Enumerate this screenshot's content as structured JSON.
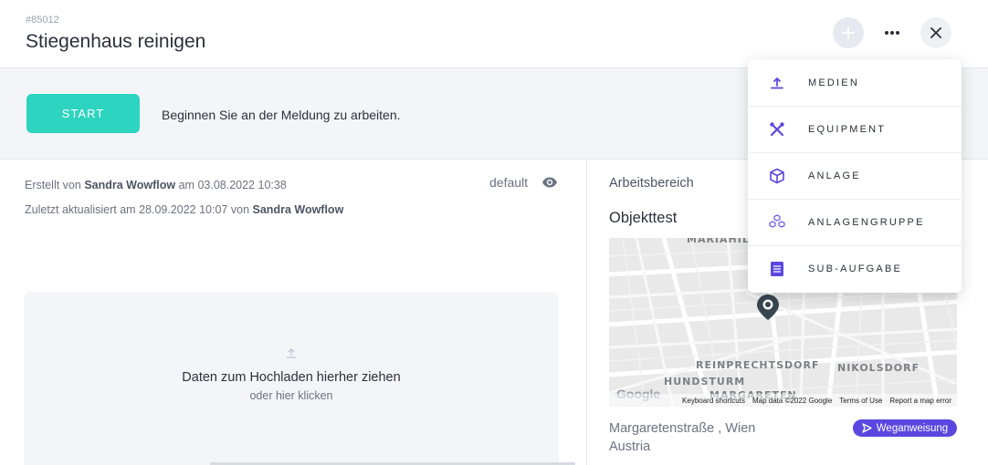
{
  "header": {
    "ticket_id": "#85012",
    "title": "Stiegenhaus reinigen",
    "add_icon": "plus-icon",
    "more_icon": "ellipsis-icon",
    "close_icon": "close-icon"
  },
  "start_band": {
    "start_label": "START",
    "hint": "Beginnen Sie an der Meldung zu arbeiten."
  },
  "meta": {
    "created_prefix": "Erstellt von",
    "created_by": "Sandra Wowflow",
    "created_mid": "am",
    "created_at": "03.08.2022 10:38",
    "updated_prefix": "Zuletzt aktualisiert am",
    "updated_at": "28.09.2022 10:07",
    "updated_mid": "von",
    "updated_by": "Sandra Wowflow",
    "view_label": "default"
  },
  "dropzone": {
    "title": "Daten zum Hochladen hierher ziehen",
    "subtitle": "oder hier klicken"
  },
  "work_area": {
    "label": "Arbeitsbereich",
    "object_name": "Objekttest"
  },
  "map": {
    "labels": [
      "MARIAHILF",
      "REINPRECHTSDORF",
      "NIKOLSDORF",
      "HUNDSTURM",
      "MARGARETEN"
    ],
    "google": "Google",
    "footer": [
      "Keyboard shortcuts",
      "Map data ©2022 Google",
      "Terms of Use",
      "Report a map error"
    ]
  },
  "address": {
    "line1": "Margaretenstraße , Wien",
    "line2": "Austria",
    "route_label": "Weganweisung"
  },
  "dropdown": {
    "items": [
      {
        "label": "MEDIEN",
        "icon": "upload-icon"
      },
      {
        "label": "EQUIPMENT",
        "icon": "tools-icon"
      },
      {
        "label": "ANLAGE",
        "icon": "cube-icon"
      },
      {
        "label": "ANLAGENGRUPPE",
        "icon": "cubes-icon"
      },
      {
        "label": "SUB-AUFGABE",
        "icon": "list-icon"
      }
    ]
  },
  "colors": {
    "accent": "#5b47e0",
    "start": "#2dd4bf"
  }
}
